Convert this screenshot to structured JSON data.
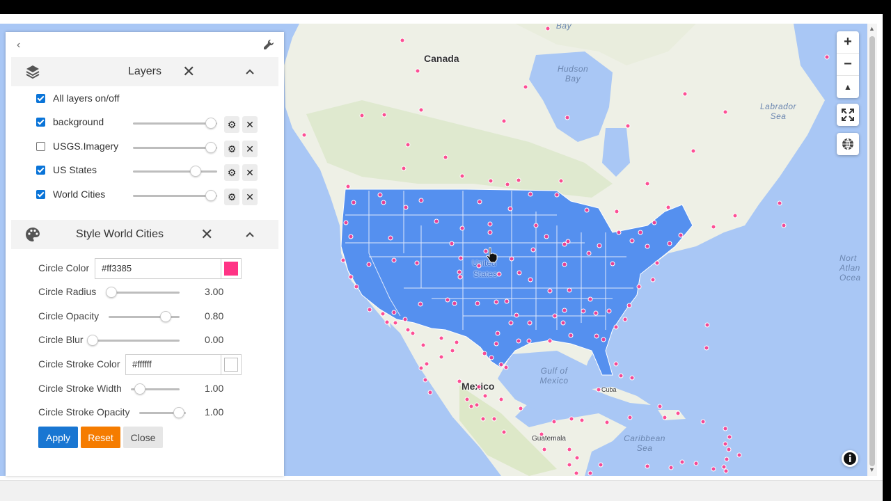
{
  "map": {
    "labels": {
      "canada": "Canada",
      "united_states_1": "United",
      "united_states_2": "States",
      "mexico": "Mexico",
      "cuba": "Cuba",
      "guatemala": "Guatemala"
    },
    "water": {
      "hudson_bay_1": "Hudson",
      "hudson_bay_2": "Bay",
      "labrador_sea_1": "Labrador",
      "labrador_sea_2": "Sea",
      "gulf_1": "Gulf of",
      "gulf_2": "Mexico",
      "caribbean_1": "Caribbean",
      "caribbean_2": "Sea",
      "north_atlantic_1": "Nort",
      "north_atlantic_2": "Atlan",
      "north_atlantic_3": "Ocea",
      "top_bay": "Bay"
    },
    "controls": {
      "zoom_in": "+",
      "zoom_out": "−",
      "reset_north": "▲",
      "fullscreen_icon": "fullscreen-icon",
      "globe_icon": "globe-icon",
      "info_icon": "info-icon"
    },
    "colors": {
      "us_fill": "#5590ef",
      "land": "#eef0e6",
      "water": "#a9c7f5",
      "city_point": "#ff3385"
    }
  },
  "panel": {
    "back": "‹",
    "layers": {
      "title": "Layers",
      "all_label": "All layers on/off",
      "all_checked": true,
      "items": [
        {
          "name": "background",
          "checked": true,
          "opacity": 1.0
        },
        {
          "name": "USGS.Imagery",
          "checked": false,
          "opacity": 1.0
        },
        {
          "name": "US States",
          "checked": true,
          "opacity": 0.7
        },
        {
          "name": "World Cities",
          "checked": true,
          "opacity": 1.0
        }
      ],
      "close": "✕",
      "collapse": "^"
    },
    "style": {
      "title": "Style World Cities",
      "close": "✕",
      "collapse": "^",
      "circle_color_label": "Circle Color",
      "circle_color_value": "#ff3385",
      "circle_radius_label": "Circle Radius",
      "circle_radius_value": "3.00",
      "circle_opacity_label": "Circle Opacity",
      "circle_opacity_value": "0.80",
      "circle_blur_label": "Circle Blur",
      "circle_blur_value": "0.00",
      "stroke_color_label": "Circle Stroke Color",
      "stroke_color_value": "#ffffff",
      "stroke_width_label": "Circle Stroke Width",
      "stroke_width_value": "1.00",
      "stroke_opacity_label": "Circle Stroke Opacity",
      "stroke_opacity_value": "1.00"
    },
    "buttons": {
      "apply": "Apply",
      "reset": "Reset",
      "close": "Close"
    }
  }
}
